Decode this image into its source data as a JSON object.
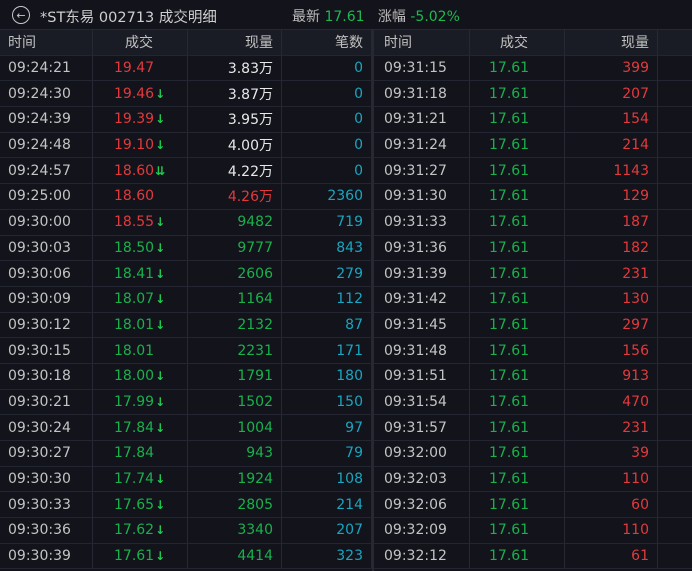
{
  "header": {
    "title": "*ST东易 002713 成交明细",
    "latest_label": "最新",
    "latest_value": "17.61",
    "change_label": "涨幅",
    "change_value": "-5.02%",
    "back_icon": "back-circle-icon"
  },
  "colors": {
    "red": "#e23a3c",
    "green": "#1ab14c",
    "cyan": "#19a6c0",
    "bg": "#12131b"
  },
  "left_table": {
    "columns": [
      "时间",
      "成交",
      "现量",
      "笔数"
    ],
    "rows": [
      [
        "09:24:21",
        "19.47",
        "red",
        "",
        "3.83万",
        "white",
        "0"
      ],
      [
        "09:24:30",
        "19.46",
        "red",
        "down",
        "3.87万",
        "white",
        "0"
      ],
      [
        "09:24:39",
        "19.39",
        "red",
        "down",
        "3.95万",
        "white",
        "0"
      ],
      [
        "09:24:48",
        "19.10",
        "red",
        "down",
        "4.00万",
        "white",
        "0"
      ],
      [
        "09:24:57",
        "18.60",
        "red",
        "double-down",
        "4.22万",
        "white",
        "0"
      ],
      [
        "09:25:00",
        "18.60",
        "red",
        "",
        "4.26万",
        "red",
        "2360"
      ],
      [
        "09:30:00",
        "18.55",
        "red",
        "down",
        "9482",
        "green",
        "719"
      ],
      [
        "09:30:03",
        "18.50",
        "green",
        "down",
        "9777",
        "green",
        "843"
      ],
      [
        "09:30:06",
        "18.41",
        "green",
        "down",
        "2606",
        "green",
        "279"
      ],
      [
        "09:30:09",
        "18.07",
        "green",
        "down",
        "1164",
        "green",
        "112"
      ],
      [
        "09:30:12",
        "18.01",
        "green",
        "down",
        "2132",
        "green",
        "87"
      ],
      [
        "09:30:15",
        "18.01",
        "green",
        "",
        "2231",
        "green",
        "171"
      ],
      [
        "09:30:18",
        "18.00",
        "green",
        "down",
        "1791",
        "green",
        "180"
      ],
      [
        "09:30:21",
        "17.99",
        "green",
        "down",
        "1502",
        "green",
        "150"
      ],
      [
        "09:30:24",
        "17.84",
        "green",
        "down",
        "1004",
        "green",
        "97"
      ],
      [
        "09:30:27",
        "17.84",
        "green",
        "",
        "943",
        "green",
        "79"
      ],
      [
        "09:30:30",
        "17.74",
        "green",
        "down",
        "1924",
        "green",
        "108"
      ],
      [
        "09:30:33",
        "17.65",
        "green",
        "down",
        "2805",
        "green",
        "214"
      ],
      [
        "09:30:36",
        "17.62",
        "green",
        "down",
        "3340",
        "green",
        "207"
      ],
      [
        "09:30:39",
        "17.61",
        "green",
        "down",
        "4414",
        "green",
        "323"
      ]
    ]
  },
  "right_table": {
    "columns": [
      "时间",
      "成交",
      "现量"
    ],
    "rows": [
      [
        "09:31:15",
        "17.61",
        "399"
      ],
      [
        "09:31:18",
        "17.61",
        "207"
      ],
      [
        "09:31:21",
        "17.61",
        "154"
      ],
      [
        "09:31:24",
        "17.61",
        "214"
      ],
      [
        "09:31:27",
        "17.61",
        "1143"
      ],
      [
        "09:31:30",
        "17.61",
        "129"
      ],
      [
        "09:31:33",
        "17.61",
        "187"
      ],
      [
        "09:31:36",
        "17.61",
        "182"
      ],
      [
        "09:31:39",
        "17.61",
        "231"
      ],
      [
        "09:31:42",
        "17.61",
        "130"
      ],
      [
        "09:31:45",
        "17.61",
        "297"
      ],
      [
        "09:31:48",
        "17.61",
        "156"
      ],
      [
        "09:31:51",
        "17.61",
        "913"
      ],
      [
        "09:31:54",
        "17.61",
        "470"
      ],
      [
        "09:31:57",
        "17.61",
        "231"
      ],
      [
        "09:32:00",
        "17.61",
        "39"
      ],
      [
        "09:32:03",
        "17.61",
        "110"
      ],
      [
        "09:32:06",
        "17.61",
        "60"
      ],
      [
        "09:32:09",
        "17.61",
        "110"
      ],
      [
        "09:32:12",
        "17.61",
        "61"
      ]
    ]
  }
}
